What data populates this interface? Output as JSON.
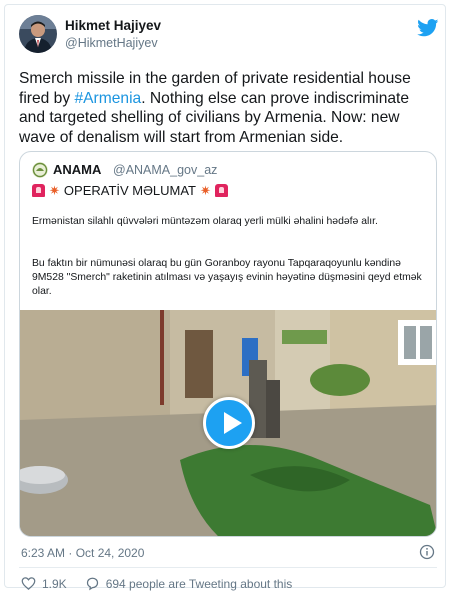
{
  "author": {
    "name": "Hikmet Hajiyev",
    "handle": "@HikmetHajiyev"
  },
  "tweet": {
    "text_before": "Smerch missile in the garden of private residential house fired by ",
    "hashtag": "#Armenia",
    "text_after": ". Nothing else can prove indiscriminate and targeted shelling of civilians by Armenia. Now: new wave of denalism will start from Armenian side."
  },
  "quoted": {
    "name": "ANAMA",
    "handle": "@ANAMA_gov_az",
    "headline": "OPERATİV MƏLUMAT",
    "paragraph1": "Ermənistan silahlı qüvvələri müntəzəm olaraq yerli mülki əhalini hədəfə alır.",
    "paragraph2": "Bu faktın bir nümunəsi olaraq bu  gün Goranboy rayonu Tapqaraqoyunlu kəndinə 9M528 \"Smerch\" raketinin atılması və yaşayış evinin həyətinə düşməsini qeyd etmək olar."
  },
  "timestamp": "6:23 AM · Oct 24, 2020",
  "stats": {
    "likes": "1.9K",
    "tweeting": "694 people are Tweeting about this"
  },
  "colors": {
    "link": "#1b95e0",
    "twitter_blue": "#1da1f2",
    "muted": "#657786"
  }
}
